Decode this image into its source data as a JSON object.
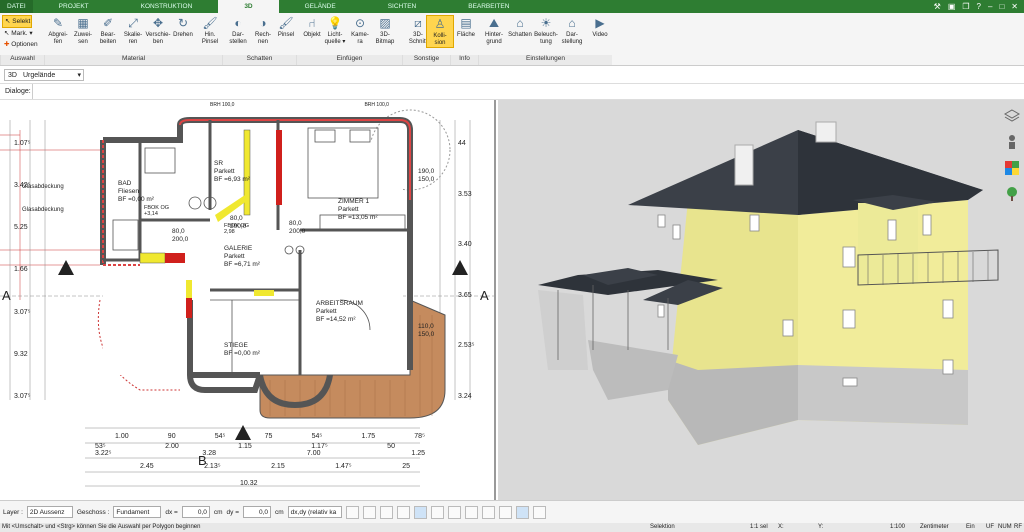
{
  "tabs": [
    "DATEI",
    "PROJEKT",
    "KONSTRUKTION",
    "3D",
    "GELÄNDE",
    "SICHTEN",
    "BEARBEITEN"
  ],
  "active_tab": "3D",
  "selection": {
    "selekt": "Selekt",
    "mark": "Mark.",
    "optionen": "Optionen"
  },
  "ribbon_buttons": [
    {
      "label": "Abgrei-\nfen",
      "icon": "eyedropper-icon"
    },
    {
      "label": "Zuwei-\nsen",
      "icon": "paint-icon"
    },
    {
      "label": "Bear-\nbeiten",
      "icon": "edit-icon"
    },
    {
      "label": "Skalie-\nren",
      "icon": "scale-icon"
    },
    {
      "label": "Verschie-\nben",
      "icon": "move-icon"
    },
    {
      "label": "Drehen",
      "icon": "rotate-icon"
    },
    {
      "label": "Hin.\nPinsel",
      "icon": "brush-icon"
    },
    {
      "label": "Dar-\nstellen",
      "icon": "shadow-show-icon"
    },
    {
      "label": "Rech-\nnen",
      "icon": "shadow-calc-icon"
    },
    {
      "label": "Pinsel",
      "icon": "brush-icon"
    },
    {
      "label": "Objekt",
      "icon": "chair-icon"
    },
    {
      "label": "Licht-\nquelle ▾",
      "icon": "bulb-icon"
    },
    {
      "label": "Kame-\nra",
      "icon": "camera-icon"
    },
    {
      "label": "3D-\nBitmap",
      "icon": "picture-icon"
    },
    {
      "label": "3D-\nSchnitt",
      "icon": "section-icon"
    },
    {
      "label": "Kolli-\nsion",
      "icon": "person-icon"
    },
    {
      "label": "Fläche",
      "icon": "info-icon"
    },
    {
      "label": "Hinter-\ngrund",
      "icon": "background-icon"
    },
    {
      "label": "Schatten",
      "icon": "house-shadow-icon"
    },
    {
      "label": "Beleuch-\ntung",
      "icon": "lighting-icon"
    },
    {
      "label": "Dar-\nstellung",
      "icon": "house-display-icon"
    },
    {
      "label": "Video",
      "icon": "play-icon"
    }
  ],
  "groups": [
    "Auswahl",
    "Material",
    "Schatten",
    "Einfügen",
    "Sonstige",
    "Info",
    "Einstellungen"
  ],
  "view_selector": {
    "mode": "3D",
    "value": "Urgelände"
  },
  "dialog_label": "Dialoge:",
  "plan": {
    "rooms": [
      {
        "name": "BAD",
        "floor": "Fliesen",
        "area": "BF =0,00 m²"
      },
      {
        "name": "SR",
        "floor": "Parkett",
        "area": "BF =6,93 m²"
      },
      {
        "name": "ZIMMER 1",
        "floor": "Parkett",
        "area": "BF =13,05 m²"
      },
      {
        "name": "GALERIE",
        "floor": "Parkett",
        "area": "BF =6,71 m²"
      },
      {
        "name": "ARBEITSRAUM",
        "floor": "Parkett",
        "area": "BF =14,52 m²"
      },
      {
        "name": "STIEGE",
        "floor": "",
        "area": "BF =0,00 m²"
      }
    ],
    "labels": [
      "FBOK OG",
      "+3,14",
      "FBOK OG",
      "2,98",
      "80,0",
      "200,0",
      "80,0",
      "200,0",
      "80,0",
      "200,0",
      "190,0",
      "150,0",
      "110,0",
      "150,0",
      "Glasabdeckung",
      "Glasabdeckung",
      "A",
      "A",
      "B"
    ],
    "bottom_dims_1": [
      "1.00",
      "90",
      "54⁵",
      "75",
      "54⁵",
      "1.75",
      "78⁵"
    ],
    "bottom_dims_2": [
      "53⁵",
      "2.00",
      "1.15",
      "1.17⁵",
      "50"
    ],
    "bottom_dims_3": [
      "3.22⁵",
      "3.28",
      "7.00",
      "1.25"
    ],
    "bottom_dims_4": [
      "2.45",
      "2.13⁵",
      "2.15",
      "1.47⁵",
      "25"
    ],
    "bottom_dims_5": [
      "10.32"
    ],
    "left_dims": [
      "1.07⁵",
      "3.42⁵",
      "5.25",
      "1.66",
      "3.07⁵",
      "9.32",
      "3.07⁵"
    ],
    "right_dims": [
      "44",
      "3.53",
      "3.40",
      "3.65",
      "2.53⁵",
      "3.24"
    ],
    "top_dims": [
      "BRH 100,0",
      "BRH 100,0"
    ]
  },
  "status": {
    "layer_label": "Layer :",
    "layer_value": "2D Aussenz",
    "floor_label": "Geschoss :",
    "floor_value": "Fundament",
    "dx_label": "dx =",
    "dx_value": "0,0",
    "dy_label": "dy =",
    "dy_value": "0,0",
    "unit": "cm",
    "dxdy_value": "dx,dy (relativ ka"
  },
  "footer": {
    "hint": "Mit <Umschalt> und <Strg> können Sie die Auswahl per Polygon beginnen",
    "mode": "Selektion",
    "sel": "1:1 sel",
    "x": "X:",
    "y": "Y:",
    "scale": "1:100",
    "unit": "Zentimeter",
    "ein": "Ein",
    "uf": "UF",
    "num": "NUM",
    "rf": "RF"
  },
  "colors": {
    "green": "#2e7d32",
    "wall": "#555555",
    "yellow_wall": "#f0e830",
    "red": "#d0201c",
    "facade": "#f1ec9a",
    "roof": "#3b4048"
  }
}
